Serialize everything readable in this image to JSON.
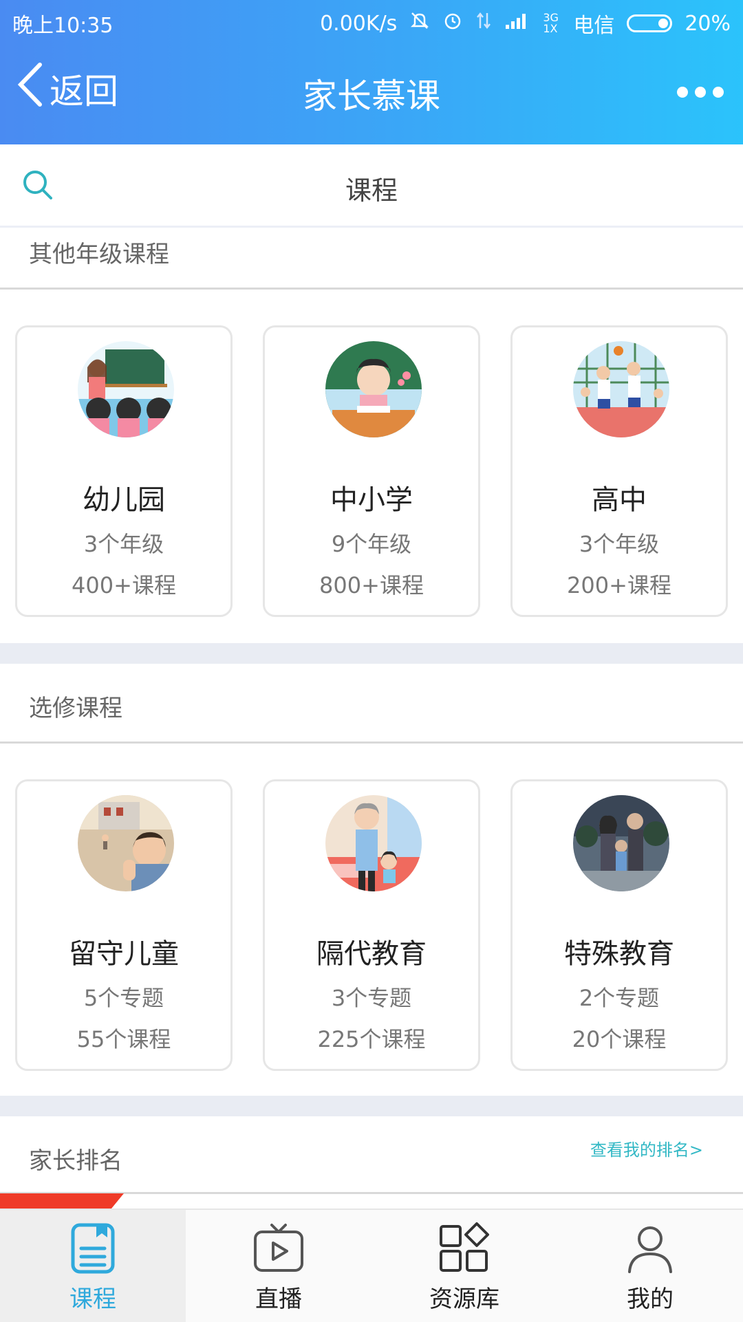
{
  "status_bar": {
    "time": "晚上10:35",
    "speed": "0.00K/s",
    "network": "3G 1X",
    "carrier": "电信",
    "battery": "20%"
  },
  "header": {
    "back_label": "返回",
    "title": "家长慕课"
  },
  "tab": {
    "label": "课程"
  },
  "sections": {
    "other_grades": {
      "title": "其他年级课程",
      "cards": [
        {
          "name": "幼儿园",
          "line1": "3个年级",
          "line2": "400+课程"
        },
        {
          "name": "中小学",
          "line1": "9个年级",
          "line2": "800+课程"
        },
        {
          "name": "高中",
          "line1": "3个年级",
          "line2": "200+课程"
        }
      ]
    },
    "electives": {
      "title": "选修课程",
      "cards": [
        {
          "name": "留守儿童",
          "line1": "5个专题",
          "line2": "55个课程"
        },
        {
          "name": "隔代教育",
          "line1": "3个专题",
          "line2": "225个课程"
        },
        {
          "name": "特殊教育",
          "line1": "2个专题",
          "line2": "20个课程"
        }
      ]
    },
    "ranking": {
      "title": "家长排名",
      "link": "查看我的排名>"
    }
  },
  "bottom_nav": {
    "items": [
      {
        "label": "课程",
        "icon": "course-book-icon"
      },
      {
        "label": "直播",
        "icon": "tv-play-icon"
      },
      {
        "label": "资源库",
        "icon": "grid-apps-icon"
      },
      {
        "label": "我的",
        "icon": "person-icon"
      }
    ]
  },
  "colors": {
    "header_gradient_start": "#4a8bf2",
    "header_gradient_end": "#2bc3fb",
    "accent": "#2fa9dc",
    "ranking_bar": "#ef3b28"
  }
}
